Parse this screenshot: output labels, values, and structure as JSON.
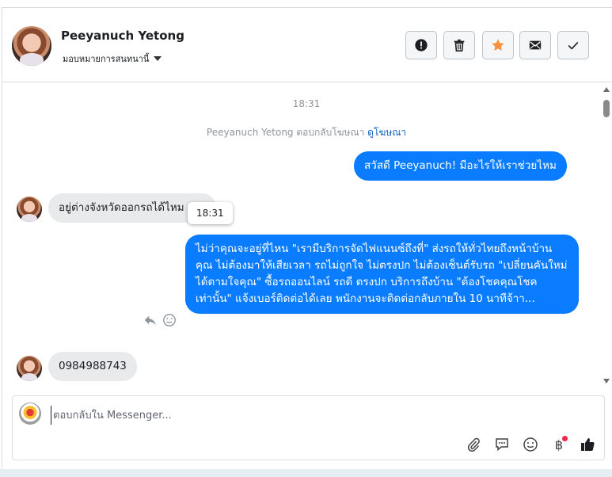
{
  "header": {
    "contact_name": "Peeyanuch Yetong",
    "assign_label": "มอบหมายการสนทนานี้",
    "buttons": {
      "spam": "spam-icon",
      "delete": "trash-icon",
      "star": "star-icon",
      "unread": "envelope-icon",
      "done": "check-icon"
    },
    "star_color": "#f7923a"
  },
  "thread": {
    "timestamp": "18:31",
    "reply_note_prefix": "Peeyanuch Yetong ตอบกลับโฆษณา",
    "reply_note_link": "ดูโฆษณา",
    "messages": [
      {
        "from": "page",
        "text": "สวัสดี Peeyanuch! มีอะไรให้เราช่วยไหม"
      },
      {
        "from": "user",
        "text": "อยู่ต่างจังหวัดออกรถได้ไหม"
      },
      {
        "from": "page",
        "text": "ไม่ว่าคุณจะอยู่ที่ไหน \"เรามีบริการจัดไฟแนนซ์ถึงที่\"  ส่งรถให้ทั่วไทยถึงหน้าบ้านคุณ ไม่ต้องมาให้เสียเวลา รถไม่ถูกใจ ไม่ตรงปก ไม่ต้องเซ็นต์รับรถ \"เปลี่ยนคันใหม่ได้ตามใจคุณ\" ซื้อรถออนไลน์ รถดี ตรงปก บริการถึงบ้าน \"ต้องโชคคุณโชคเท่านั้น\" แจ้งเบอร์ติดต่อได้เลย พนักงานจะติดต่อกลับภายใน 10 นาทีจ้าา..."
      },
      {
        "from": "user",
        "text": "0984988743"
      }
    ],
    "tooltip": "18:31",
    "accent_color": "#0a7cff"
  },
  "composer": {
    "placeholder": "ตอบกลับใน Messenger...",
    "tools": [
      "paperclip-icon",
      "saved-reply-icon",
      "emoji-icon",
      "baht-icon",
      "thumbs-up-icon"
    ],
    "baht_symbol": "฿"
  }
}
